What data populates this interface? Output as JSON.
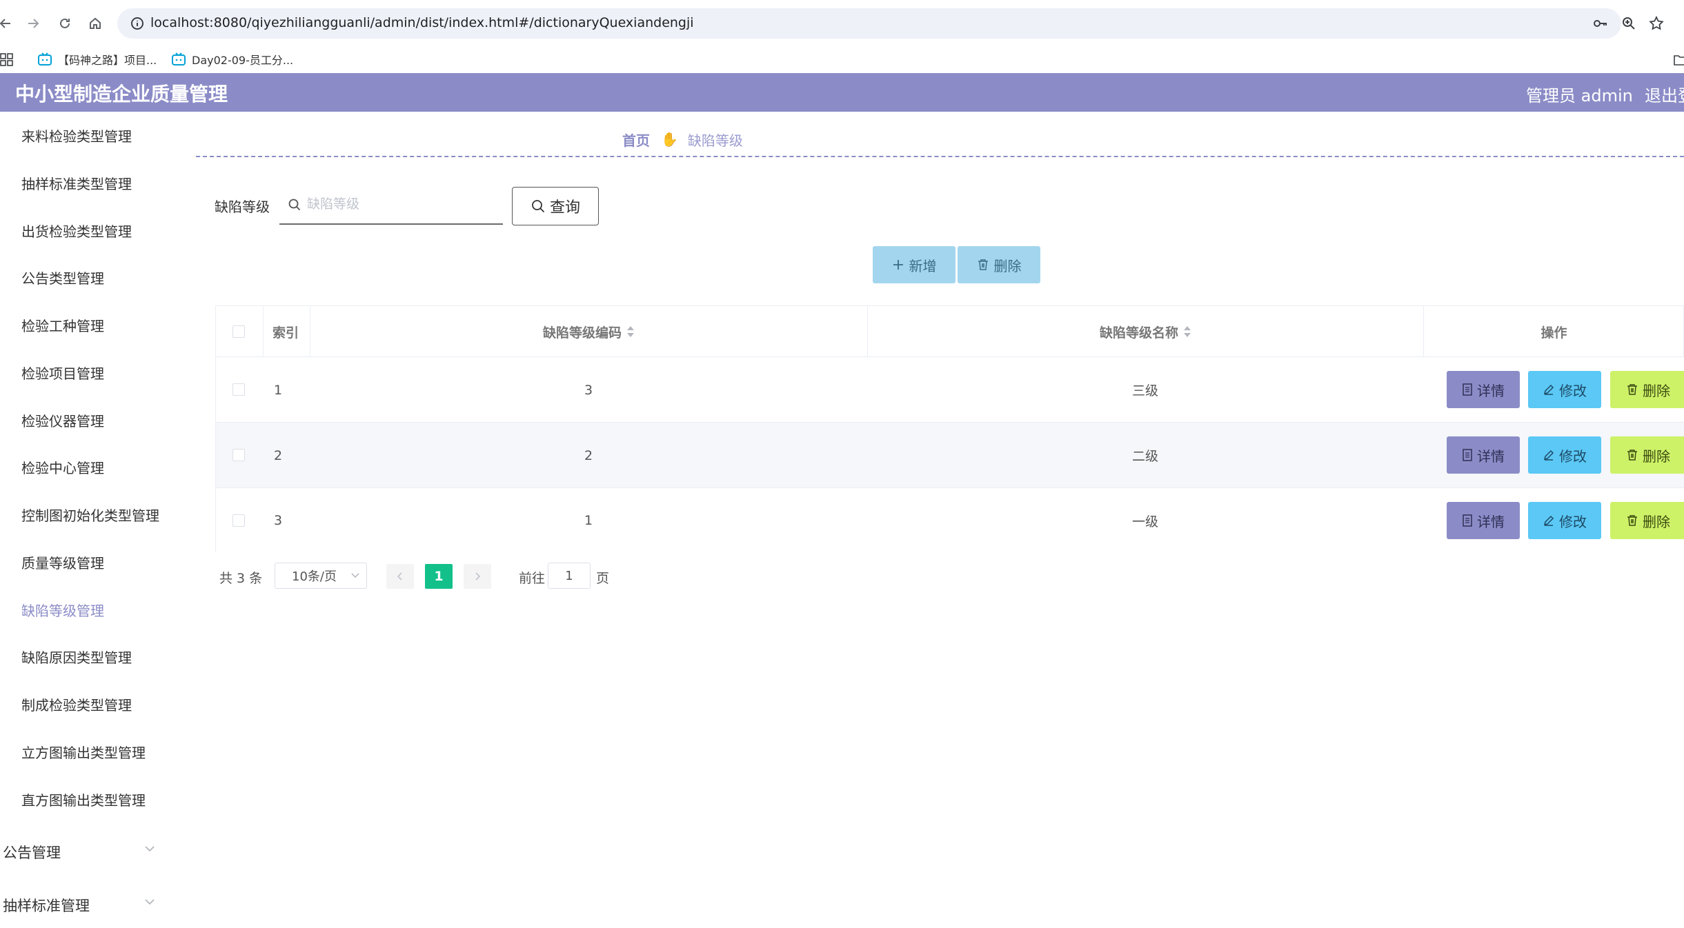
{
  "browser": {
    "url": "localhost:8080/qiyezhiliangguanli/admin/dist/index.html#/dictionaryQuexiandengji",
    "bookmarks": [
      "【码神之路】项目...",
      "Day02-09-员工分..."
    ]
  },
  "header": {
    "title": "中小型制造企业质量管理",
    "user": "管理员 admin",
    "logout": "退出登"
  },
  "sidebar": {
    "items": [
      "来料检验类型管理",
      "抽样标准类型管理",
      "出货检验类型管理",
      "公告类型管理",
      "检验工种管理",
      "检验项目管理",
      "检验仪器管理",
      "检验中心管理",
      "控制图初始化类型管理",
      "质量等级管理",
      "缺陷等级管理",
      "缺陷原因类型管理",
      "制成检验类型管理",
      "立方图输出类型管理",
      "直方图输出类型管理"
    ],
    "active_item": "缺陷等级管理",
    "groups": [
      "公告管理",
      "抽样标准管理"
    ]
  },
  "breadcrumb": {
    "home": "首页",
    "current": "缺陷等级"
  },
  "search": {
    "label": "缺陷等级",
    "placeholder": "缺陷等级",
    "value": "",
    "button": "查询"
  },
  "actions": {
    "add": "新增",
    "delete": "删除"
  },
  "table": {
    "columns": [
      "索引",
      "缺陷等级编码",
      "缺陷等级名称",
      "操作"
    ],
    "rows": [
      {
        "index": "1",
        "code": "3",
        "name": "三级"
      },
      {
        "index": "2",
        "code": "2",
        "name": "二级"
      },
      {
        "index": "3",
        "code": "1",
        "name": "一级"
      }
    ],
    "row_actions": {
      "detail": "详情",
      "edit": "修改",
      "delete": "删除"
    }
  },
  "pagination": {
    "total": "共 3 条",
    "page_size": "10条/页",
    "current_page": "1",
    "goto_label": "前往",
    "goto_value": "1",
    "page_unit": "页"
  },
  "colors": {
    "header": "#8b8cc7",
    "active": "#8b8cc7",
    "detail_btn": "#8b8cc7",
    "edit_btn": "#5bc8f5",
    "delete_btn": "#cdf268",
    "pager_active": "#13c08a",
    "toolbar_btn": "#a3d6ee"
  }
}
